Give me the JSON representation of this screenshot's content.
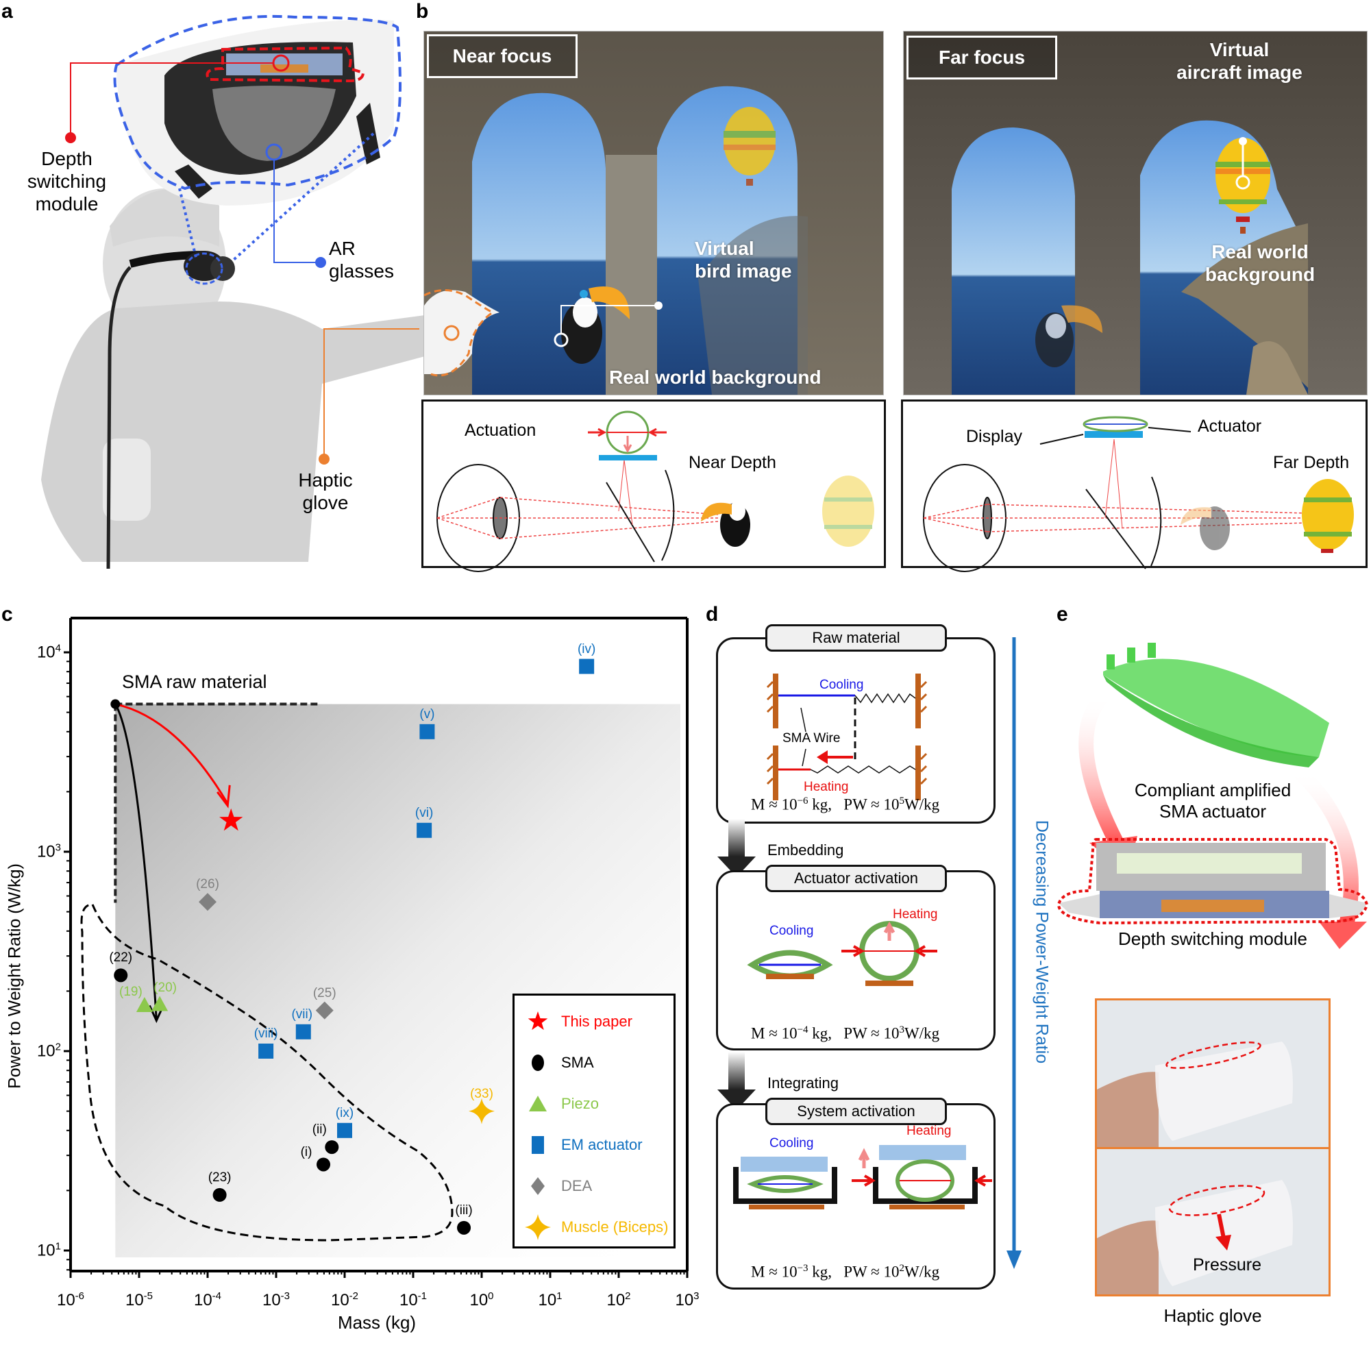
{
  "panels": {
    "a": {
      "letter": "a",
      "labels": {
        "depth_switching_module": [
          "Depth",
          "switching",
          "module"
        ],
        "ar_glasses": [
          "AR",
          "glasses"
        ],
        "haptic_glove": [
          "Haptic",
          "glove"
        ]
      },
      "colors": {
        "depth_module": "#e8141c",
        "ar_glasses": "#3a62e6",
        "haptic_glove": "#ec8030"
      }
    },
    "b": {
      "letter": "b",
      "near": {
        "focus_label": "Near focus",
        "virtual_label": [
          "Virtual",
          "bird image"
        ],
        "background_label": "Real world background",
        "diagram": {
          "actuation_label": "Actuation",
          "depth_label": "Near Depth"
        }
      },
      "far": {
        "focus_label": "Far focus",
        "virtual_label": [
          "Virtual",
          "aircraft image"
        ],
        "background_label": [
          "Real world",
          "background"
        ],
        "diagram": {
          "display_label": "Display",
          "actuator_label": "Actuator",
          "depth_label": "Far Depth"
        }
      }
    },
    "c": {
      "letter": "c"
    },
    "d": {
      "letter": "d",
      "side_label": "Decreasing Power-Weight Ratio",
      "side_color": "#1f73c0",
      "stages": [
        {
          "title": "Raw material",
          "labels": {
            "cooling": "Cooling",
            "wire": "SMA Wire",
            "heating": "Heating"
          },
          "mass_exp": "−6",
          "pw_exp": "5"
        },
        {
          "transition": "Embedding",
          "title": "Actuator activation",
          "labels": {
            "cooling": "Cooling",
            "heating": "Heating"
          },
          "mass_exp": "−4",
          "pw_exp": "3"
        },
        {
          "transition": "Integrating",
          "title": "System activation",
          "labels": {
            "cooling": "Cooling",
            "heating": "Heating"
          },
          "mass_exp": "−3",
          "pw_exp": "2"
        }
      ],
      "formula": {
        "mass_prefix": "M ≈ 10",
        "mass_unit": " kg,",
        "pw_prefix": "PW ≈ 10",
        "pw_unit": "W/kg"
      }
    },
    "e": {
      "letter": "e",
      "actuator_label": [
        "Compliant amplified",
        "SMA actuator"
      ],
      "module_label": "Depth switching module",
      "pressure_label": "Pressure",
      "glove_label": "Haptic glove"
    }
  },
  "chart_data": {
    "type": "scatter",
    "title": "",
    "xlabel": "Mass (kg)",
    "ylabel": "Power to Weight Ratio (W/kg)",
    "xscale": "log",
    "yscale": "log",
    "xlim": [
      1e-06,
      1000.0
    ],
    "ylim": [
      7,
      15000
    ],
    "xticks": [
      -6,
      -5,
      -4,
      -3,
      -2,
      -1,
      0,
      1,
      2,
      3
    ],
    "yticks": [
      1,
      2,
      3,
      4
    ],
    "grid": false,
    "legend_position": "bottom-right",
    "annotation": {
      "text": "SMA raw material",
      "mass": 4.5e-06,
      "pw": 5500
    },
    "arrows": [
      {
        "from": "SMA raw material",
        "to": "This paper",
        "color": "#ff0000"
      },
      {
        "from": "SMA raw material",
        "to": "SMA cluster",
        "color": "#000000"
      }
    ],
    "series": [
      {
        "name": "This paper",
        "marker": "star",
        "color": "#ff0000",
        "points": [
          {
            "label": "",
            "mass": 0.00022,
            "pw": 1430
          }
        ]
      },
      {
        "name": "SMA",
        "marker": "circle",
        "color": "#000000",
        "points": [
          {
            "label": "(22)",
            "mass": 5.4e-06,
            "pw": 240
          },
          {
            "label": "(23)",
            "mass": 0.00015,
            "pw": 19
          },
          {
            "label": "(i)",
            "mass": 0.0049,
            "pw": 27
          },
          {
            "label": "(ii)",
            "mass": 0.0065,
            "pw": 33
          },
          {
            "label": "(iii)",
            "mass": 0.55,
            "pw": 13
          }
        ]
      },
      {
        "name": "Piezo",
        "marker": "triangle",
        "color": "#8cc84b",
        "points": [
          {
            "label": "(19)",
            "mass": 1.2e-05,
            "pw": 170
          },
          {
            "label": "(20)",
            "mass": 2e-05,
            "pw": 172
          }
        ]
      },
      {
        "name": "EM actuator",
        "marker": "square",
        "color": "#0e6fbf",
        "points": [
          {
            "label": "(iv)",
            "mass": 34,
            "pw": 8500
          },
          {
            "label": "(v)",
            "mass": 0.16,
            "pw": 4000
          },
          {
            "label": "(vi)",
            "mass": 0.145,
            "pw": 1280
          },
          {
            "label": "(vii)",
            "mass": 0.0025,
            "pw": 125
          },
          {
            "label": "(viii)",
            "mass": 0.00071,
            "pw": 100
          },
          {
            "label": "(ix)",
            "mass": 0.01,
            "pw": 40
          }
        ]
      },
      {
        "name": "DEA",
        "marker": "diamond",
        "color": "#808080",
        "points": [
          {
            "label": "(26)",
            "mass": 0.0001,
            "pw": 560
          },
          {
            "label": "(25)",
            "mass": 0.0051,
            "pw": 160
          }
        ]
      },
      {
        "name": "Muscle (Biceps)",
        "marker": "sparkle",
        "color": "#f5b800",
        "points": [
          {
            "label": "(33)",
            "mass": 1.0,
            "pw": 50
          }
        ]
      }
    ]
  }
}
